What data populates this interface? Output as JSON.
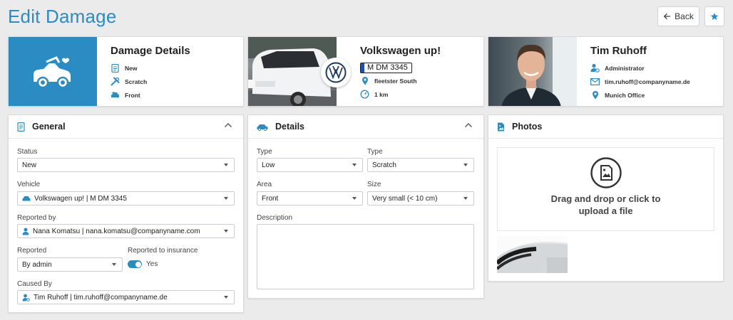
{
  "header": {
    "title": "Edit Damage",
    "back_label": "Back"
  },
  "colors": {
    "accent": "#2b8cc4",
    "background": "#ebebec"
  },
  "damage_card": {
    "title": "Damage Details",
    "items": [
      {
        "icon": "document-icon",
        "text": "New"
      },
      {
        "icon": "tools-icon",
        "text": "Scratch"
      },
      {
        "icon": "car-front-icon",
        "text": "Front"
      }
    ]
  },
  "vehicle_card": {
    "title": "Volkswagen up!",
    "plate": "M DM 3345",
    "items": [
      {
        "icon": "location-icon",
        "text": "fleetster South"
      },
      {
        "icon": "speedometer-icon",
        "text": "1 km"
      }
    ]
  },
  "person_card": {
    "name": "Tim Ruhoff",
    "items": [
      {
        "icon": "user-gear-icon",
        "text": "Administrator"
      },
      {
        "icon": "mail-icon",
        "text": "tim.ruhoff@companyname.de"
      },
      {
        "icon": "location-icon",
        "text": "Munich Office"
      }
    ]
  },
  "general": {
    "title": "General",
    "status_label": "Status",
    "status_value": "New",
    "vehicle_label": "Vehicle",
    "vehicle_value": "Volkswagen up! | M DM 3345",
    "reported_by_label": "Reported by",
    "reported_by_value": "Nana Komatsu | nana.komatsu@companyname.com",
    "reported_label": "Reported",
    "reported_value": "By admin",
    "insurance_label": "Reported to insurance",
    "insurance_value": "Yes",
    "caused_by_label": "Caused By",
    "caused_by_value": "Tim Ruhoff | tim.ruhoff@companyname.de"
  },
  "details": {
    "title": "Details",
    "type1_label": "Type",
    "type1_value": "Low",
    "type2_label": "Type",
    "type2_value": "Scratch",
    "area_label": "Area",
    "area_value": "Front",
    "size_label": "Size",
    "size_value": "Very small (< 10 cm)",
    "description_label": "Description",
    "description_value": ""
  },
  "photos": {
    "title": "Photos",
    "dropzone_text": "Drag and drop or click to upload a file"
  }
}
